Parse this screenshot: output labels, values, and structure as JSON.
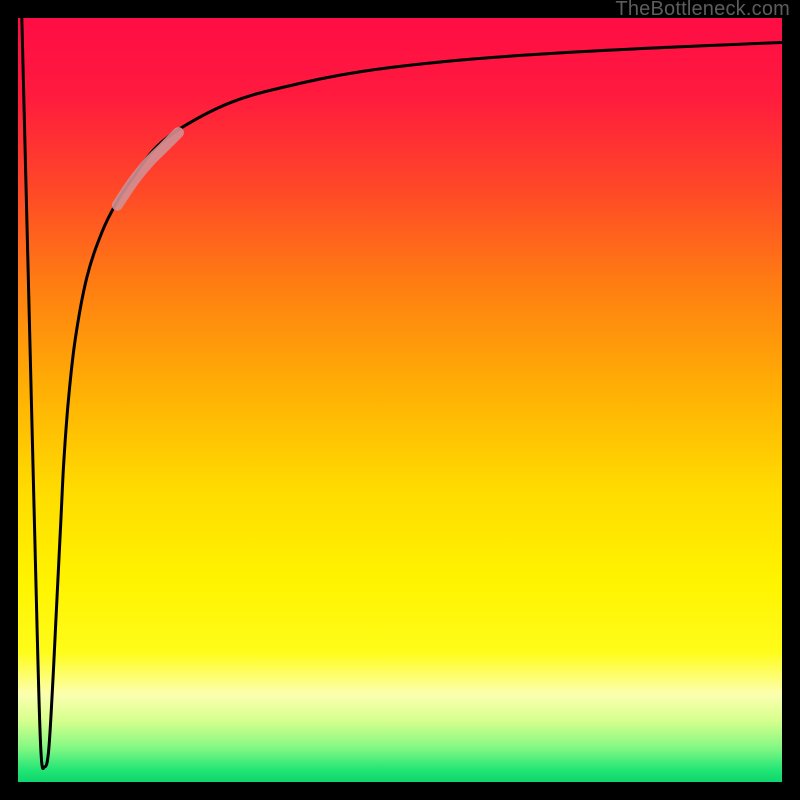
{
  "watermark": "TheBottleneck.com",
  "gradient": {
    "stops": [
      {
        "offset": 0.0,
        "color": "#ff0d45"
      },
      {
        "offset": 0.1,
        "color": "#ff1a3e"
      },
      {
        "offset": 0.22,
        "color": "#ff4628"
      },
      {
        "offset": 0.35,
        "color": "#ff7e12"
      },
      {
        "offset": 0.48,
        "color": "#ffad05"
      },
      {
        "offset": 0.62,
        "color": "#ffdc00"
      },
      {
        "offset": 0.74,
        "color": "#fff400"
      },
      {
        "offset": 0.83,
        "color": "#fffc1a"
      },
      {
        "offset": 0.885,
        "color": "#fcffb0"
      },
      {
        "offset": 0.92,
        "color": "#d6ff8e"
      },
      {
        "offset": 0.955,
        "color": "#84f884"
      },
      {
        "offset": 0.985,
        "color": "#20e574"
      },
      {
        "offset": 1.0,
        "color": "#0fd66d"
      }
    ]
  },
  "chart_data": {
    "type": "line",
    "title": "",
    "xlabel": "",
    "ylabel": "",
    "xlim": [
      0,
      100
    ],
    "ylim": [
      0,
      100
    ],
    "series": [
      {
        "name": "bottleneck-curve",
        "x": [
          0.5,
          1.5,
          2.5,
          3.0,
          3.5,
          4.0,
          4.5,
          5.0,
          5.6,
          6.0,
          6.6,
          7.5,
          9.0,
          11.0,
          13.0,
          15.0,
          18.0,
          22.0,
          28.0,
          35.0,
          45.0,
          58.0,
          72.0,
          86.0,
          100.0
        ],
        "y": [
          100,
          60,
          20,
          4,
          2,
          4,
          12,
          22,
          34,
          42,
          50,
          58,
          66,
          72,
          76,
          79,
          83,
          86,
          89,
          91,
          93,
          94.5,
          95.5,
          96.2,
          96.8
        ]
      },
      {
        "name": "highlight-segment",
        "x": [
          13.0,
          15.0,
          17.0,
          19.0,
          21.0
        ],
        "y": [
          75.5,
          78.5,
          81.0,
          83.0,
          85.0
        ]
      }
    ]
  }
}
